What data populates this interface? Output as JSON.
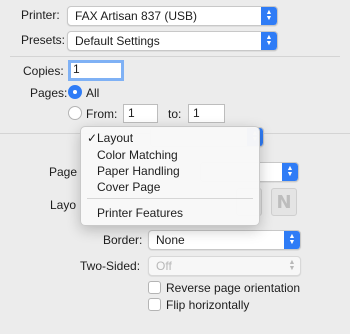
{
  "printer": {
    "label": "Printer:",
    "value": "FAX Artisan 837 (USB)"
  },
  "presets": {
    "label": "Presets:",
    "value": "Default Settings"
  },
  "copies": {
    "label": "Copies:",
    "value": "1"
  },
  "pages": {
    "label": "Pages:",
    "all_label": "All",
    "from_label": "From:",
    "from_value": "1",
    "to_label": "to:",
    "to_value": "1",
    "selected": "All"
  },
  "section_menu": {
    "items": [
      "Layout",
      "Color Matching",
      "Paper Handling",
      "Cover Page",
      "Printer Features"
    ],
    "checked": "Layout",
    "check_glyph": "✓"
  },
  "layout": {
    "pages_per_sheet_label_partial": "Page",
    "layout_direction_label_partial": "Layo",
    "orientation_glyph": "N",
    "border": {
      "label": "Border:",
      "value": "None"
    },
    "two_sided": {
      "label": "Two-Sided:",
      "value": "Off"
    },
    "reverse_orientation_label": "Reverse page orientation",
    "flip_horizontally_label": "Flip horizontally"
  },
  "colors": {
    "accent": "#2f7cf6",
    "background": "#ececec"
  }
}
